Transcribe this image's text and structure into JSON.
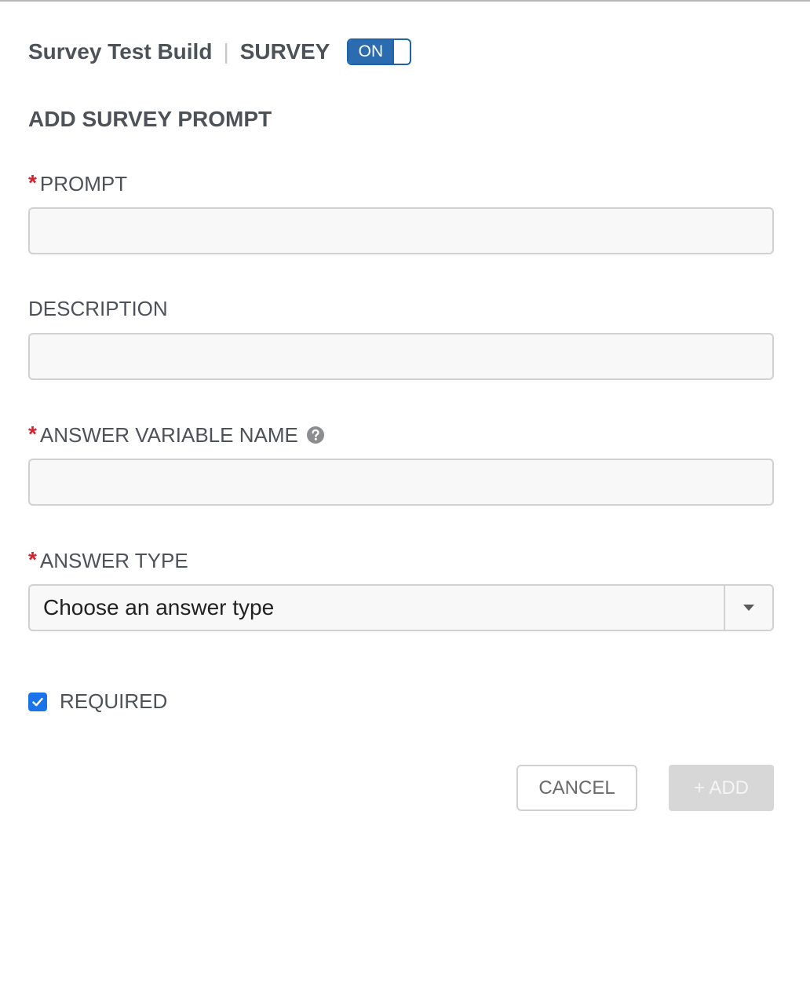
{
  "header": {
    "title": "Survey Test Build",
    "divider": "|",
    "survey_label": "SURVEY",
    "toggle": {
      "label": "ON",
      "state": "on",
      "color": "#2b6cb0"
    }
  },
  "form": {
    "section_title": "ADD SURVEY PROMPT",
    "required_marker": "*",
    "prompt": {
      "label": "PROMPT",
      "required": true,
      "value": ""
    },
    "description": {
      "label": "DESCRIPTION",
      "required": false,
      "value": ""
    },
    "answer_variable_name": {
      "label": "ANSWER VARIABLE NAME",
      "required": true,
      "value": "",
      "icon": "help-icon"
    },
    "answer_type": {
      "label": "ANSWER TYPE",
      "required": true,
      "selected": "Choose an answer type",
      "icon": "caret-down-icon"
    },
    "required_checkbox": {
      "label": "REQUIRED",
      "checked": true,
      "color": "#1a73e8"
    }
  },
  "actions": {
    "cancel_label": "CANCEL",
    "add_label": "+ ADD",
    "add_disabled": true
  },
  "colors": {
    "required_star": "#d1242f",
    "text": "#4d5258"
  }
}
